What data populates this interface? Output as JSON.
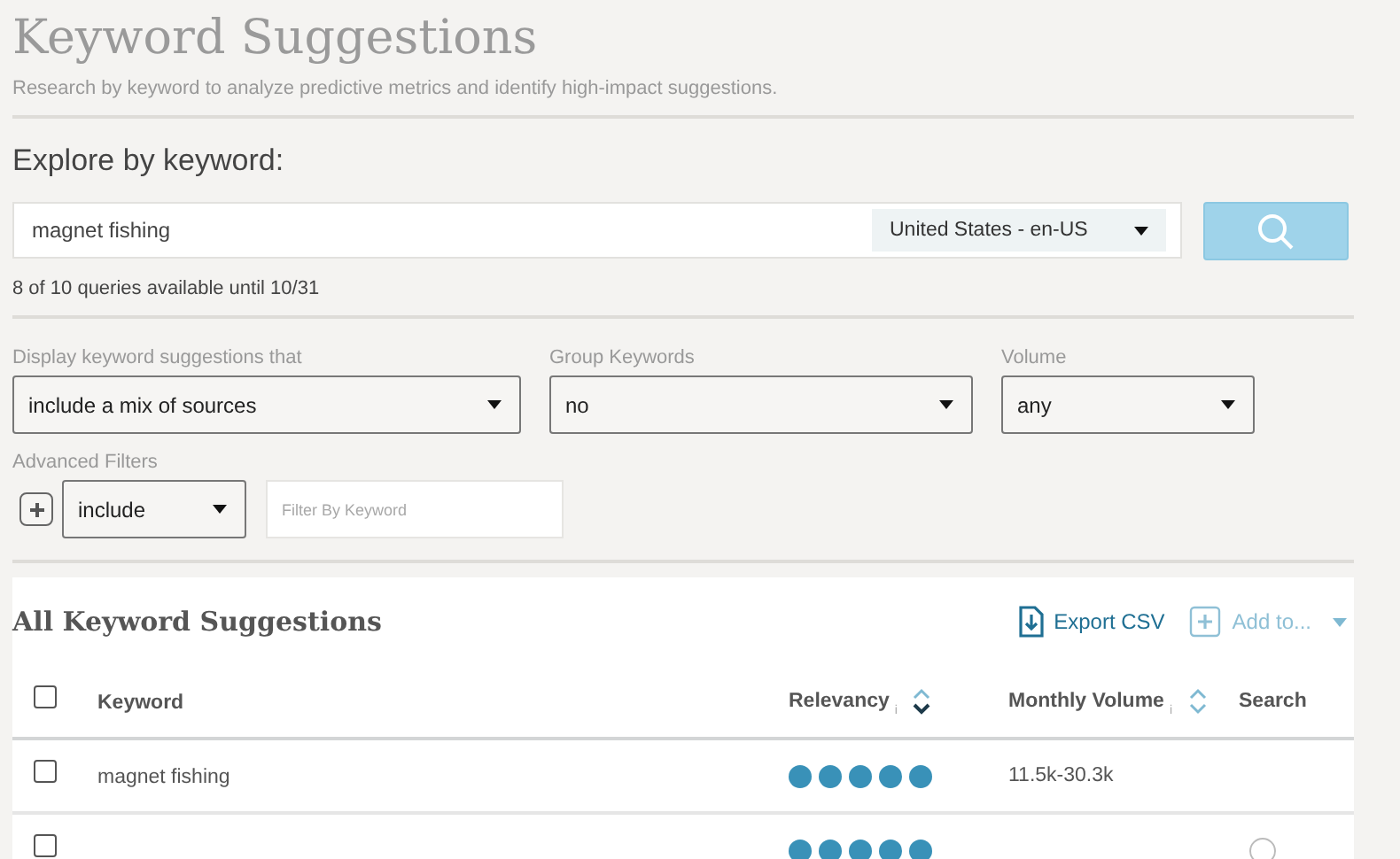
{
  "header": {
    "title": "Keyword Suggestions",
    "subtitle": "Research by keyword to analyze predictive metrics and identify high-impact suggestions."
  },
  "explore": {
    "heading": "Explore by keyword:",
    "keyword": "magnet fishing",
    "locale": "United States - en-US",
    "quota": "8 of 10 queries available until 10/31"
  },
  "filters": [
    {
      "label": "Display keyword suggestions that",
      "value": "include a mix of sources"
    },
    {
      "label": "Group Keywords",
      "value": "no"
    },
    {
      "label": "Volume",
      "value": "any"
    }
  ],
  "advanced": {
    "label": "Advanced Filters",
    "mode": "include",
    "placeholder": "Filter By Keyword"
  },
  "table": {
    "title": "All Keyword Suggestions",
    "export": "Export CSV",
    "add_to": "Add to...",
    "add_to_disabled": true,
    "columns": [
      "Keyword",
      "Relevancy",
      "Monthly Volume",
      "Search"
    ],
    "relevancy_info": "i",
    "volume_info": "i",
    "header_checked": false,
    "rows": [
      {
        "keyword": "magnet fishing",
        "stars": 5,
        "volume": "11.5k-30.3k",
        "checked": false
      },
      {
        "stars": 5,
        "checked": false
      }
    ]
  }
}
